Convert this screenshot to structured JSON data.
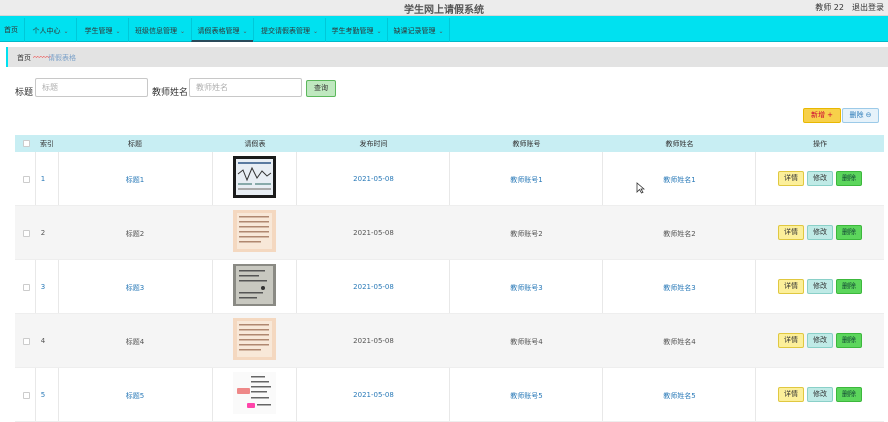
{
  "header": {
    "title": "学生网上请假系统",
    "user": "教师 22",
    "logout": "退出登录"
  },
  "nav": {
    "home": "首页",
    "items": [
      "个人中心",
      "学生管理",
      "班级信息管理",
      "请假表格管理",
      "提交请假表管理",
      "学生考勤管理",
      "缺课记录管理"
    ]
  },
  "breadcrumb": {
    "home": "首页",
    "current": "请假表格"
  },
  "search": {
    "title_label": "标题",
    "title_placeholder": "标题",
    "teacher_label": "教师姓名",
    "teacher_placeholder": "教师姓名",
    "query_button": "查询"
  },
  "toolbar": {
    "add": "新增 +",
    "delete": "删除 ⊖"
  },
  "table": {
    "headers": [
      "索引",
      "标题",
      "请假表",
      "发布时间",
      "教师账号",
      "教师姓名",
      "操作"
    ],
    "rows": [
      {
        "index": "1",
        "title": "标题1",
        "date": "2021-05-08",
        "account": "教师账号1",
        "name": "教师姓名1"
      },
      {
        "index": "2",
        "title": "标题2",
        "date": "2021-05-08",
        "account": "教师账号2",
        "name": "教师姓名2"
      },
      {
        "index": "3",
        "title": "标题3",
        "date": "2021-05-08",
        "account": "教师账号3",
        "name": "教师姓名3"
      },
      {
        "index": "4",
        "title": "标题4",
        "date": "2021-05-08",
        "account": "教师账号4",
        "name": "教师姓名4"
      },
      {
        "index": "5",
        "title": "标题5",
        "date": "2021-05-08",
        "account": "教师账号5",
        "name": "教师姓名5"
      }
    ],
    "actions": {
      "detail": "详情",
      "edit": "修改",
      "delete": "删除"
    }
  }
}
